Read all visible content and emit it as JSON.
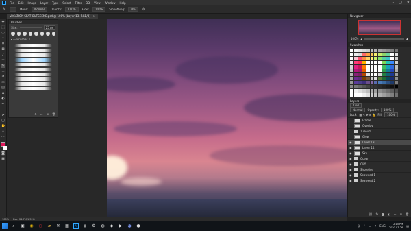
{
  "menu": [
    "File",
    "Edit",
    "Image",
    "Layer",
    "Type",
    "Select",
    "Filter",
    "3D",
    "View",
    "Window",
    "Help"
  ],
  "window_buttons": [
    "–",
    "▢",
    "✕"
  ],
  "options": {
    "mode_label": "Mode:",
    "mode_value": "Normal",
    "opacity_label": "Opacity:",
    "opacity_value": "100%",
    "flow_label": "Flow:",
    "flow_value": "100%",
    "smoothing_label": "Smoothing:",
    "smoothing_value": "0%"
  },
  "document_tab": {
    "title": "VACATION SEAT OUTSCENE.psd @ 100% (Layer 13, RGB/8)",
    "close": "×"
  },
  "brushes_panel": {
    "title": "Brushes",
    "size_label": "Size:",
    "size_value": "25 px",
    "folder_label": "Brushes 1",
    "stroke_count": 10,
    "selected_index": 3
  },
  "navigator": {
    "title": "Navigator",
    "zoom": "100%"
  },
  "swatches": {
    "title": "Swatches",
    "colors": [
      "#ffffff",
      "#f2f2f2",
      "#e6e6e6",
      "#d9d9d9",
      "#cccccc",
      "#bfbfbf",
      "#b3b3b3",
      "#a6a6a6",
      "#999999",
      "#8c8c8c",
      "#808080",
      "#737373",
      "#ffffff",
      "#ececec",
      "#dadada",
      "#ff6b6b",
      "#ff9f43",
      "#feca57",
      "#f8ef6f",
      "#c7ec6b",
      "#8fd46b",
      "#6bd49c",
      "#ffffff",
      "#e0e0e0",
      "#ffffff",
      "#f5c2d0",
      "#ff4d6d",
      "#ff8c42",
      "#ffd166",
      "#fff275",
      "#c9f26b",
      "#84e36b",
      "#52d1a0",
      "#3fc1c9",
      "#ffffff",
      "#d0d0d0",
      "#e8e8e8",
      "#ff3b7a",
      "#ff2d55",
      "#ffb400",
      "#ffffff",
      "#ffffff",
      "#ffffff",
      "#ffffff",
      "#7ed957",
      "#21c7b8",
      "#3b8bff",
      "#cfcfcf",
      "#d8d8d8",
      "#e0207f",
      "#c2185b",
      "#ff7a00",
      "#ffffff",
      "#ffffff",
      "#ffffff",
      "#ffffff",
      "#3fbf5f",
      "#17a2b8",
      "#2f6ae0",
      "#bfbfbf",
      "#c8c8c8",
      "#b3167a",
      "#9c1c6b",
      "#e65c00",
      "#ffffff",
      "#ffffff",
      "#ffffff",
      "#ffffff",
      "#2e9e4f",
      "#127f91",
      "#2647b8",
      "#aeaeae",
      "#b8b8b8",
      "#8a1f78",
      "#7a1f63",
      "#b34700",
      "#e6e6e6",
      "#ffffff",
      "#ffffff",
      "#d8d8d8",
      "#23803f",
      "#0e6374",
      "#1f3a94",
      "#9e9e9e",
      "#a8a8a8",
      "#6b2a8f",
      "#5e2a7a",
      "#7a3d00",
      "#7a5a3a",
      "#cfcfcf",
      "#dcdcdc",
      "#5a7a3a",
      "#1c6a33",
      "#0b4b58",
      "#1b2e70",
      "#8e8e8e",
      "#989898",
      "#5a3a9a",
      "#4b3d8a",
      "#3d2e7a",
      "#6a4e8a",
      "#8a6aa8",
      "#5a6ab0",
      "#4a7ab8",
      "#3a6aa0",
      "#2a4e80",
      "#1e3a6a",
      "#7e7e7e",
      "#888888",
      "#777777",
      "#666666",
      "#555555",
      "#444444",
      "#3a3a3a",
      "#333333",
      "#2a2a2a",
      "#222222",
      "#1a1a1a",
      "#111111",
      "#000000",
      "#ffffff",
      "#efefef",
      "#dfdfdf",
      "#cfcfcf",
      "#bfbfbf",
      "#afafaf",
      "#9f9f9f",
      "#8f8f8f",
      "#7f7f7f",
      "#6f6f6f",
      "#5f5f5f",
      "#4f4f4f",
      "#ffffff",
      "#ffffff",
      "#ffffff",
      "#f0f0f0",
      "#e0e0e0",
      "#d0d0d0",
      "#c0c0c0",
      "#b0b0b0",
      "#a0a0a0",
      "#909090",
      "#808080",
      "#707070"
    ]
  },
  "layers": {
    "tabs": [
      "Layers",
      "Channels",
      "Paths"
    ],
    "kind_label": "Kind",
    "blend_value": "Normal",
    "opacity_label": "Opacity:",
    "opacity_value": "100%",
    "lock_label": "Lock:",
    "fill_label": "Fill:",
    "fill_value": "100%",
    "items": [
      {
        "name": "Frame",
        "type": "layer",
        "visible": false
      },
      {
        "name": "Overlay",
        "type": "layer",
        "visible": false
      },
      {
        "name": "1 cloud",
        "type": "folder",
        "visible": false
      },
      {
        "name": "Glow",
        "type": "layer",
        "visible": false
      },
      {
        "name": "Layer 13",
        "type": "layer",
        "visible": true,
        "selected": true
      },
      {
        "name": "Layer 14",
        "type": "layer",
        "visible": true
      },
      {
        "name": "Sky",
        "type": "layer",
        "visible": true
      },
      {
        "name": "Ocean",
        "type": "folder",
        "visible": true
      },
      {
        "name": "Cliff",
        "type": "folder",
        "visible": true
      },
      {
        "name": "Shoreline",
        "type": "folder",
        "visible": true
      },
      {
        "name": "Seaweed 1",
        "type": "folder",
        "visible": true
      },
      {
        "name": "Seaweed 2",
        "type": "folder",
        "visible": true
      }
    ]
  },
  "status": {
    "zoom": "100%",
    "doc": "Doc: 24.7M/1.52G"
  },
  "taskbar": {
    "lang": "ENG",
    "time": "2:15 PM",
    "date": "2020-07-26"
  },
  "colors": {
    "foreground": "#e0185a",
    "background": "#ffffff",
    "accent": "#31a8ff"
  }
}
